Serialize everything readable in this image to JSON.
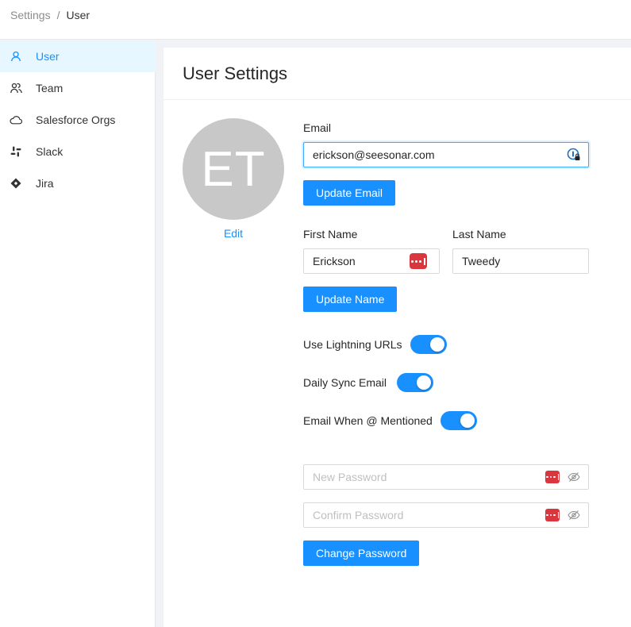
{
  "breadcrumb": {
    "parent": "Settings",
    "separator": "/",
    "current": "User"
  },
  "sidebar": {
    "items": [
      {
        "label": "User",
        "icon": "user-icon",
        "active": true
      },
      {
        "label": "Team",
        "icon": "team-icon",
        "active": false
      },
      {
        "label": "Salesforce Orgs",
        "icon": "cloud-icon",
        "active": false
      },
      {
        "label": "Slack",
        "icon": "slack-icon",
        "active": false
      },
      {
        "label": "Jira",
        "icon": "jira-icon",
        "active": false
      }
    ]
  },
  "page": {
    "title": "User Settings"
  },
  "avatar": {
    "initials": "ET",
    "edit_label": "Edit"
  },
  "email": {
    "label": "Email",
    "value": "erickson@seesonar.com",
    "button": "Update Email"
  },
  "name": {
    "first_label": "First Name",
    "first_value": "Erickson",
    "last_label": "Last Name",
    "last_value": "Tweedy",
    "button": "Update Name"
  },
  "toggles": [
    {
      "label": "Use Lightning URLs",
      "on": true
    },
    {
      "label": "Daily Sync Email",
      "on": true
    },
    {
      "label": "Email When @ Mentioned",
      "on": true
    }
  ],
  "password": {
    "new_placeholder": "New Password",
    "confirm_placeholder": "Confirm Password",
    "button": "Change Password"
  },
  "colors": {
    "primary": "#1890ff",
    "active_bg": "#e6f7ff",
    "avatar_bg": "#c8c8c8",
    "password_manager_red": "#d9363e"
  }
}
